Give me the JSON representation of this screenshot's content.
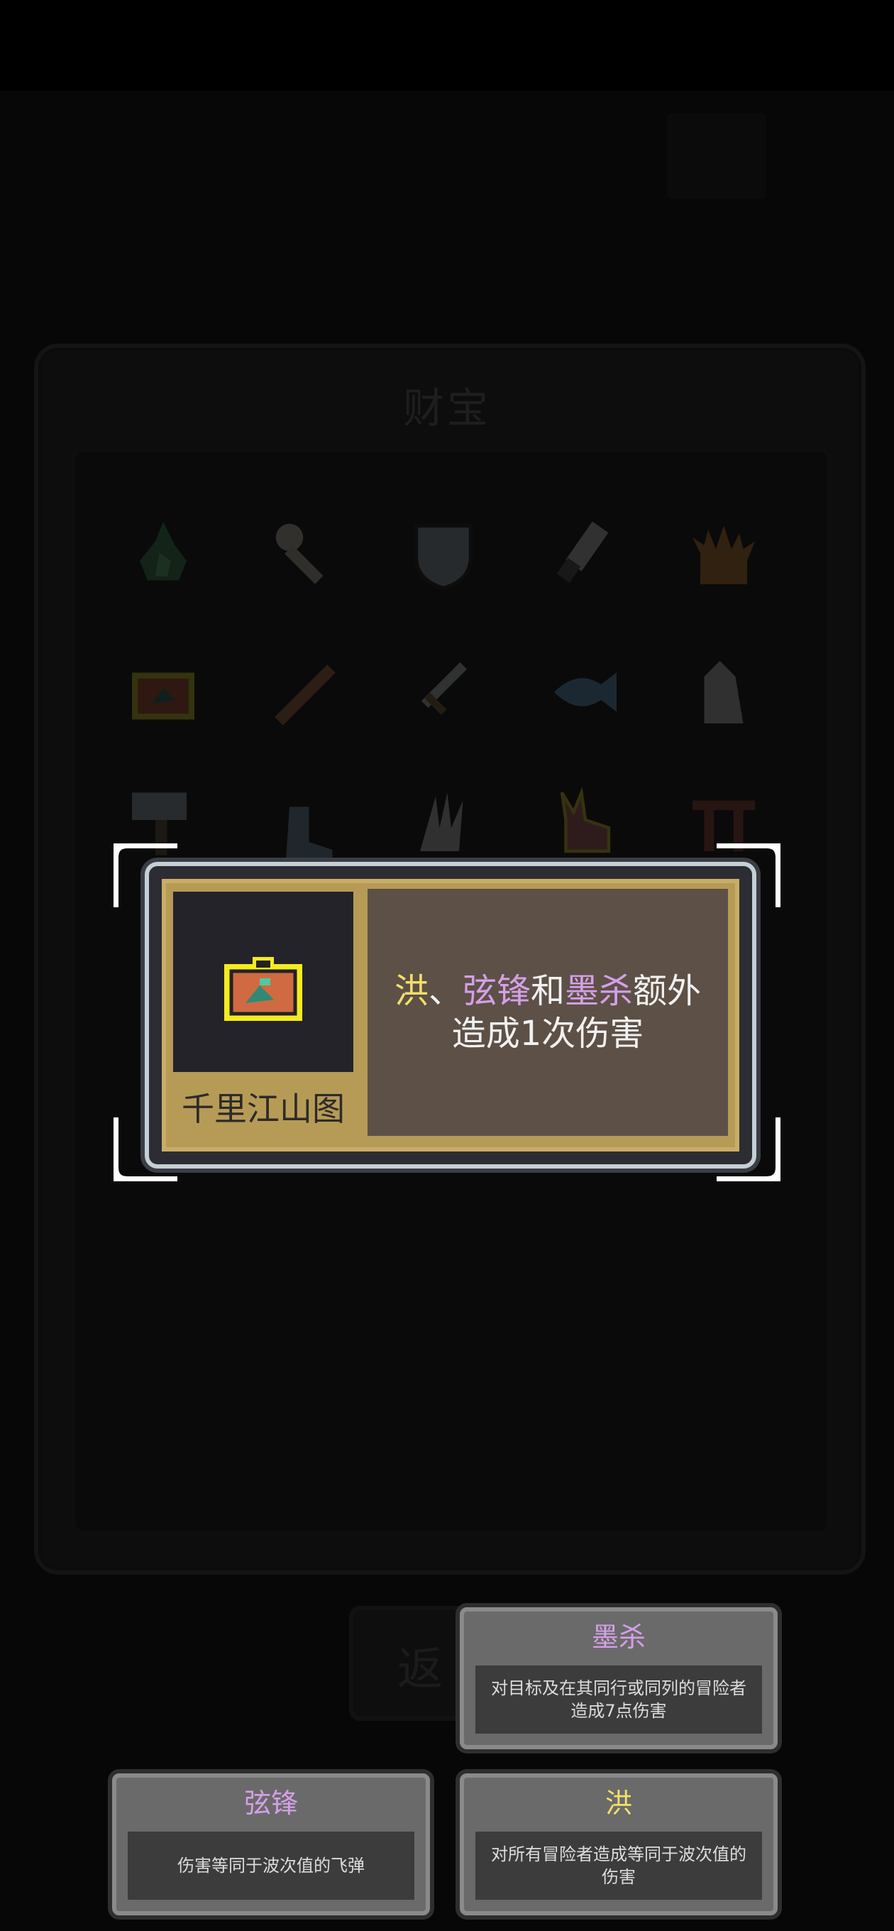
{
  "screen": {
    "panel_title": "财宝",
    "back_label": "返"
  },
  "detail": {
    "item_name": "千里江山图",
    "desc_kw1": "洪",
    "desc_sep1": "、",
    "desc_kw2": "弦锋",
    "desc_sep2": "和",
    "desc_kw3": "墨杀",
    "desc_tail1": "额外",
    "desc_line2": "造成1次伤害",
    "icon": "landscape-scroll-icon"
  },
  "tooltips": [
    {
      "title": "墨杀",
      "title_color": "#d5a0e8",
      "body": "对目标及在其同行或同列的冒险者\n造成7点伤害"
    },
    {
      "title": "弦锋",
      "title_color": "#d5a0e8",
      "body": "伤害等同于波次值的飞弹"
    },
    {
      "title": "洪",
      "title_color": "#f2e06a",
      "body": "对所有冒险者造成等同于波次值的\n伤害"
    }
  ],
  "colors": {
    "highlight_yellow": "#f2e06a",
    "highlight_purple": "#d5a0e8",
    "card_gold": "#b69b57"
  }
}
